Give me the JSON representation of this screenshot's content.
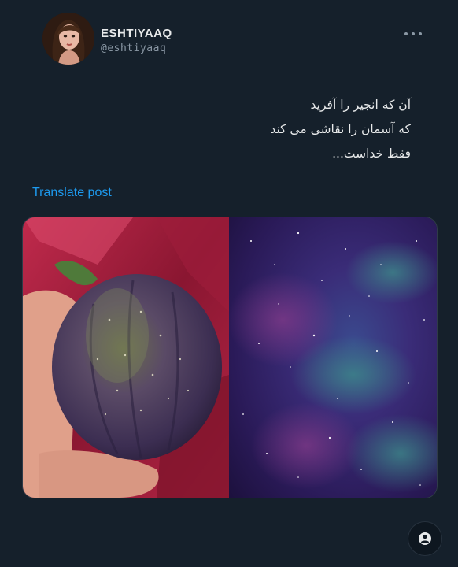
{
  "author": {
    "display_name": "ESHTIYAAQ",
    "handle": "@eshtiyaaq",
    "avatar_icon": "profile-photo"
  },
  "post": {
    "lines": [
      "آن که انجیر را آفرید",
      "که آسمان را نقاشی می کند",
      "فقط خداست..."
    ],
    "translate_label": "Translate post"
  },
  "media": {
    "left_image": "fig-in-hand-photo",
    "right_image": "purple-starry-galaxy-photo"
  },
  "icons": {
    "more": "more-horizontal-icon",
    "fab": "account-circle-icon"
  },
  "colors": {
    "background": "#15202b",
    "link": "#1d9bf0",
    "secondary_text": "#8b98a5"
  }
}
